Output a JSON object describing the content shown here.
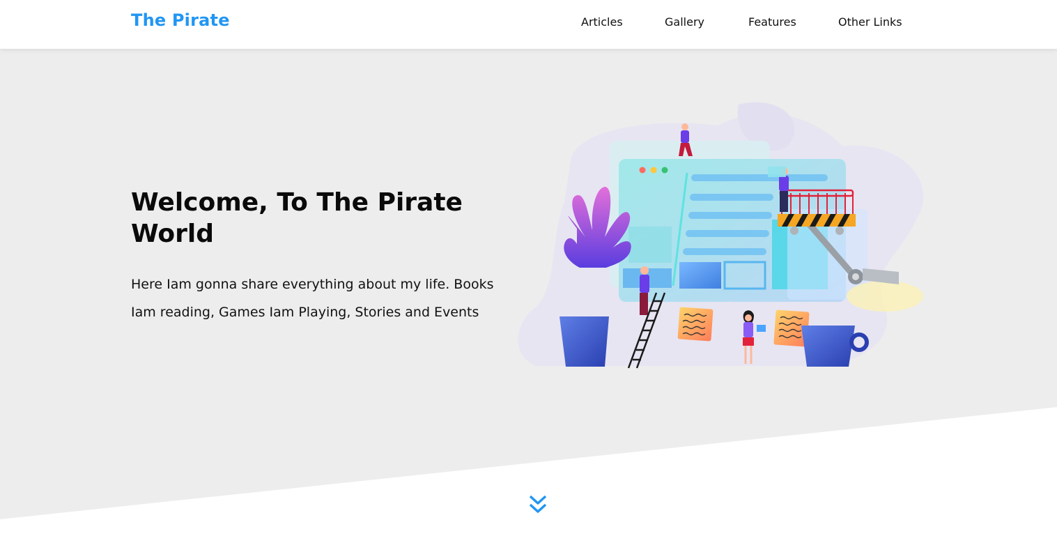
{
  "nav": {
    "brand": "The Pirate",
    "links": [
      "Articles",
      "Gallery",
      "Features",
      "Other Links"
    ]
  },
  "hero": {
    "title": "Welcome, To The Pirate World",
    "text": "Here Iam gonna share everything about my life. Books Iam reading, Games Iam Playing, Stories and Events"
  },
  "icons": {
    "scroll": "double-chevron-down-icon",
    "illustration": "web-development-team-illustration"
  },
  "colors": {
    "brand": "#2196f3",
    "hero_bg": "#ededed",
    "text": "#111111"
  }
}
